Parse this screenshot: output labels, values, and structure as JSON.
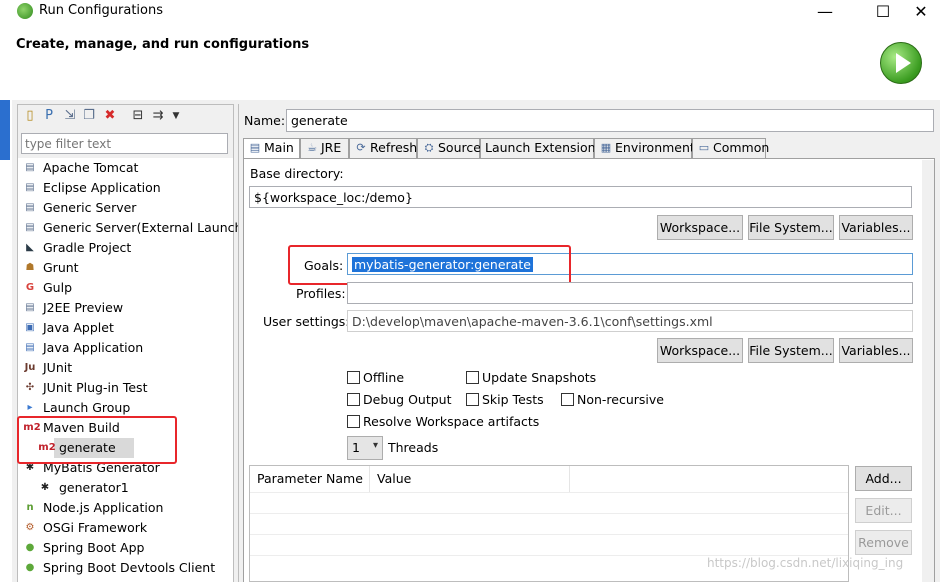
{
  "window": {
    "title": "Run Configurations",
    "minimize": "—",
    "maximize": "☐",
    "close": "✕"
  },
  "header": {
    "title": "Create, manage, and run configurations"
  },
  "left": {
    "filter_placeholder": "type filter text",
    "tree": [
      {
        "label": "Apache Tomcat",
        "icon": "doc-icon",
        "glyph": "▤",
        "color": "#5a6e8c"
      },
      {
        "label": "Eclipse Application",
        "icon": "doc-icon",
        "glyph": "▤",
        "color": "#5a6e8c"
      },
      {
        "label": "Generic Server",
        "icon": "doc-icon",
        "glyph": "▤",
        "color": "#5a6e8c"
      },
      {
        "label": "Generic Server(External Launch)",
        "icon": "doc-icon",
        "glyph": "▤",
        "color": "#5a6e8c"
      },
      {
        "label": "Gradle Project",
        "icon": "gradle-icon",
        "glyph": "◣",
        "color": "#2b3b47"
      },
      {
        "label": "Grunt",
        "icon": "grunt-icon",
        "glyph": "☗",
        "color": "#b0782b"
      },
      {
        "label": "Gulp",
        "icon": "gulp-icon",
        "glyph": "G",
        "color": "#d8423c"
      },
      {
        "label": "J2EE Preview",
        "icon": "doc-icon",
        "glyph": "▤",
        "color": "#5a6e8c"
      },
      {
        "label": "Java Applet",
        "icon": "applet-icon",
        "glyph": "▣",
        "color": "#3d6cb4"
      },
      {
        "label": "Java Application",
        "icon": "java-app-icon",
        "glyph": "▤",
        "color": "#3d6cb4"
      },
      {
        "label": "JUnit",
        "icon": "junit-icon",
        "glyph": "Ju",
        "color": "#6b3a2e"
      },
      {
        "label": "JUnit Plug-in Test",
        "icon": "junit-plugin-icon",
        "glyph": "✣",
        "color": "#6b3a2e"
      },
      {
        "label": "Launch Group",
        "icon": "launch-group-icon",
        "glyph": "▸",
        "color": "#3c7ad1"
      },
      {
        "label": "Maven Build",
        "icon": "maven-icon",
        "glyph": "m2",
        "color": "#c0212b"
      },
      {
        "label": "generate",
        "icon": "maven-icon",
        "glyph": "m2",
        "color": "#c0212b",
        "child": true,
        "selected": true
      },
      {
        "label": "MyBatis Generator",
        "icon": "mybatis-icon",
        "glyph": "✱",
        "color": "#222"
      },
      {
        "label": "generator1",
        "icon": "mybatis-icon",
        "glyph": "✱",
        "color": "#222",
        "child": true
      },
      {
        "label": "Node.js Application",
        "icon": "nodejs-icon",
        "glyph": "n",
        "color": "#5d9e34"
      },
      {
        "label": "OSGi Framework",
        "icon": "osgi-icon",
        "glyph": "⚙",
        "color": "#b35c2a"
      },
      {
        "label": "Spring Boot App",
        "icon": "spring-icon",
        "glyph": "●",
        "color": "#5da83a"
      },
      {
        "label": "Spring Boot Devtools Client",
        "icon": "spring-icon",
        "glyph": "●",
        "color": "#5da83a"
      }
    ]
  },
  "right": {
    "name_label": "Name:",
    "name_value": "generate",
    "tabs": [
      {
        "label": "Main",
        "icon": "main-tab-icon",
        "glyph": "▤",
        "active": true
      },
      {
        "label": "JRE",
        "icon": "jre-icon",
        "glyph": "☕"
      },
      {
        "label": "Refresh",
        "icon": "refresh-icon",
        "glyph": "⟳"
      },
      {
        "label": "Source",
        "icon": "source-icon",
        "glyph": "⛭"
      },
      {
        "label": "Launch Extensions",
        "icon": "",
        "glyph": ""
      },
      {
        "label": "Environment",
        "icon": "environment-icon",
        "glyph": "▦"
      },
      {
        "label": "Common",
        "icon": "common-icon",
        "glyph": "▭"
      }
    ],
    "base_dir_label": "Base directory:",
    "base_dir_value": "${workspace_loc:/demo}",
    "workspace_btn": "Workspace...",
    "filesystem_btn": "File System...",
    "variables_btn": "Variables...",
    "goals_label": "Goals:",
    "goals_value": "mybatis-generator:generate",
    "profiles_label": "Profiles:",
    "profiles_value": "",
    "user_settings_label": "User settings:",
    "user_settings_value": "D:\\develop\\maven\\apache-maven-3.6.1\\conf\\settings.xml",
    "checkboxes": {
      "offline": "Offline",
      "update_snapshots": "Update Snapshots",
      "debug_output": "Debug Output",
      "skip_tests": "Skip Tests",
      "non_recursive": "Non-recursive",
      "resolve_workspace": "Resolve Workspace artifacts"
    },
    "threads_value": "1",
    "threads_label": "Threads",
    "param_col_name": "Parameter Name",
    "param_col_value": "Value",
    "add_btn": "Add...",
    "edit_btn": "Edit...",
    "remove_btn": "Remove"
  },
  "watermark": "https://blog.csdn.net/lixiqing_ing"
}
